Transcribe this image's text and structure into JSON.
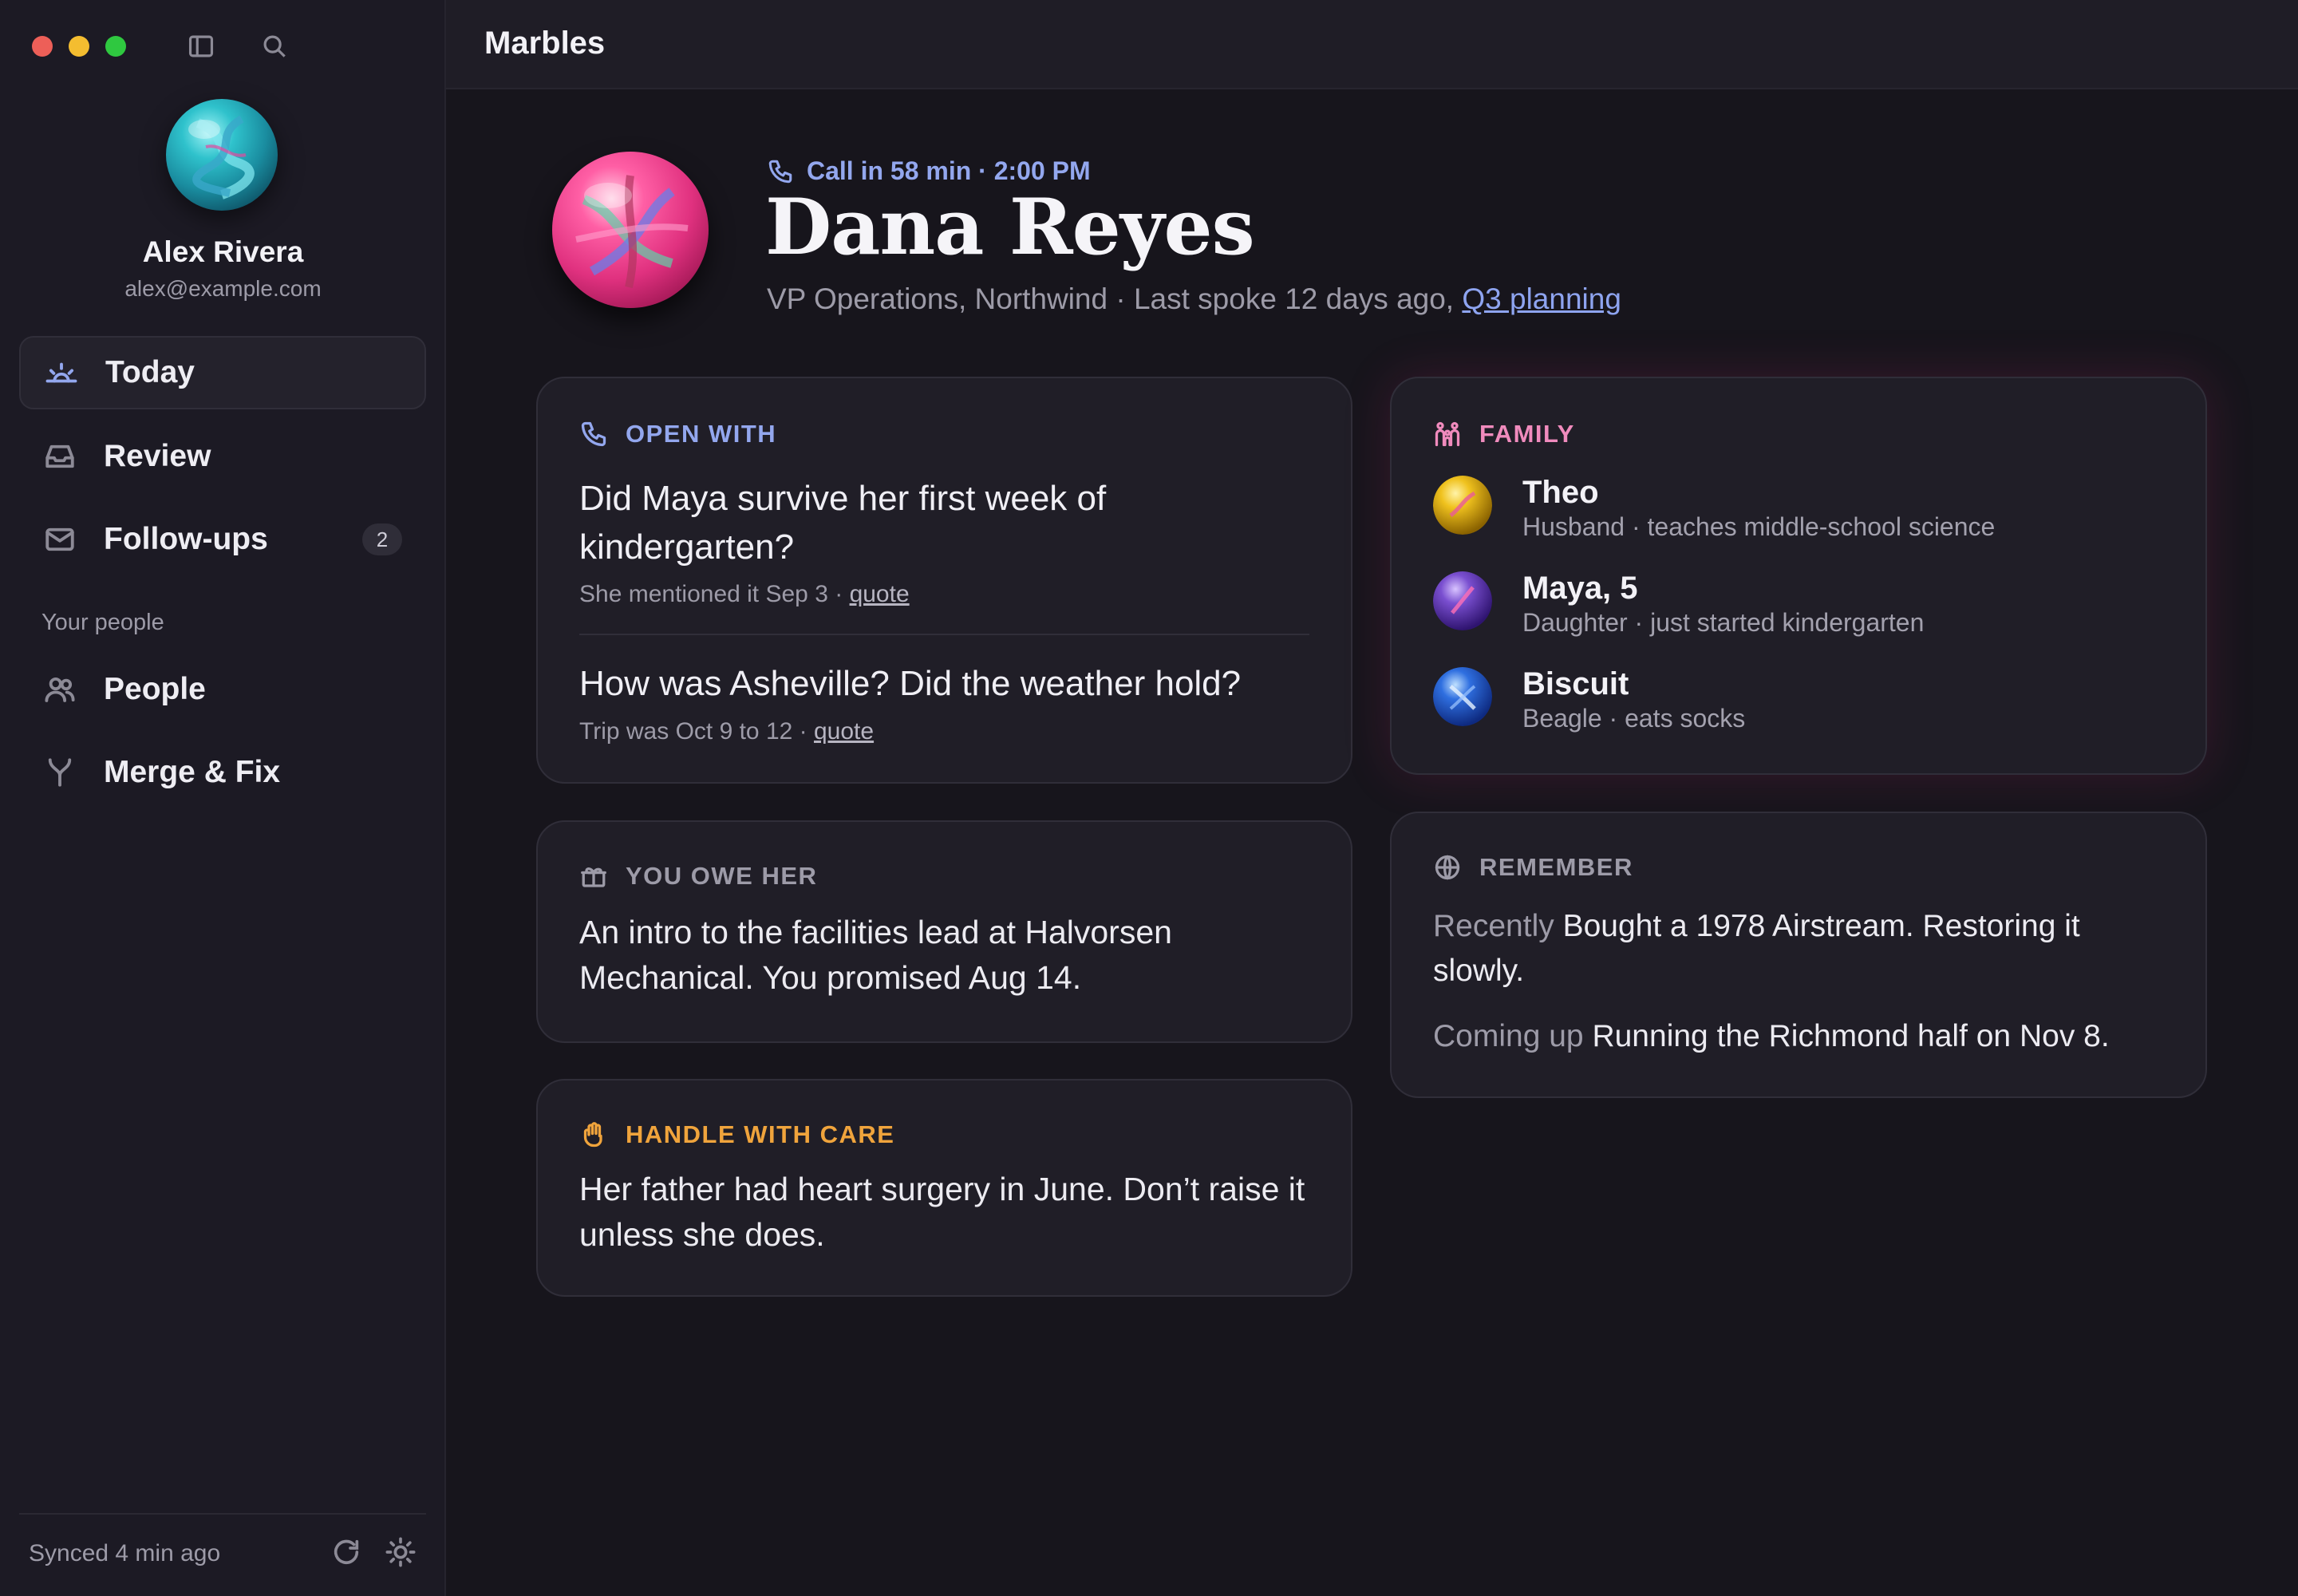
{
  "window": {
    "title": "Marbles"
  },
  "user": {
    "name": "Alex Rivera",
    "email": "alex@example.com"
  },
  "sidebar": {
    "nav": [
      {
        "label": "Today",
        "icon": "sunrise-icon"
      },
      {
        "label": "Review",
        "icon": "inbox-icon"
      },
      {
        "label": "Follow-ups",
        "icon": "mail-icon",
        "badge": "2"
      }
    ],
    "section_label": "Your people",
    "people_nav": [
      {
        "label": "People",
        "icon": "people-icon"
      },
      {
        "label": "Merge & Fix",
        "icon": "merge-icon"
      }
    ],
    "footer": {
      "synced": "Synced 4 min ago"
    }
  },
  "person": {
    "call": "Call in 58 min · 2:00 PM",
    "name": "Dana Reyes",
    "subtitle": "VP Operations, Northwind · Last spoke 12 days ago,",
    "subtitle_link": "Q3 planning"
  },
  "open_with": {
    "heading": "OPEN WITH",
    "items": [
      {
        "question": "Did Maya survive her first week of kindergarten?",
        "meta": "She mentioned it Sep 3 ·",
        "link": "quote"
      },
      {
        "question": "How was Asheville? Did the weather hold?",
        "meta": "Trip was Oct 9 to 12 ·",
        "link": "quote"
      }
    ]
  },
  "you_owe": {
    "heading": "YOU OWE HER",
    "text": "An intro to the facilities lead at Halvorsen Mechanical. You promised Aug 14."
  },
  "handle_care": {
    "heading": "HANDLE WITH CARE",
    "text": "Her father had heart surgery in June. Don’t raise it unless she does."
  },
  "family": {
    "heading": "FAMILY",
    "members": [
      {
        "name": "Theo",
        "desc": "Husband · teaches middle-school science",
        "color": "#e5b21c"
      },
      {
        "name": "Maya, 5",
        "desc": "Daughter · just started kindergarten",
        "color": "#7a4fd0"
      },
      {
        "name": "Biscuit",
        "desc": "Beagle · eats socks",
        "color": "#2f6fe0"
      }
    ]
  },
  "remember": {
    "heading": "REMEMBER",
    "items": [
      {
        "label": "Recently",
        "text": "Bought a 1978 Airstream. Restoring it slowly."
      },
      {
        "label": "Coming up",
        "text": "Running the Richmond half on Nov 8."
      }
    ]
  },
  "colors": {
    "accent_blue": "#93a7ee",
    "family_pink": "#f08bbd",
    "care_orange": "#f0a43c",
    "muted": "#9d9ba8"
  }
}
